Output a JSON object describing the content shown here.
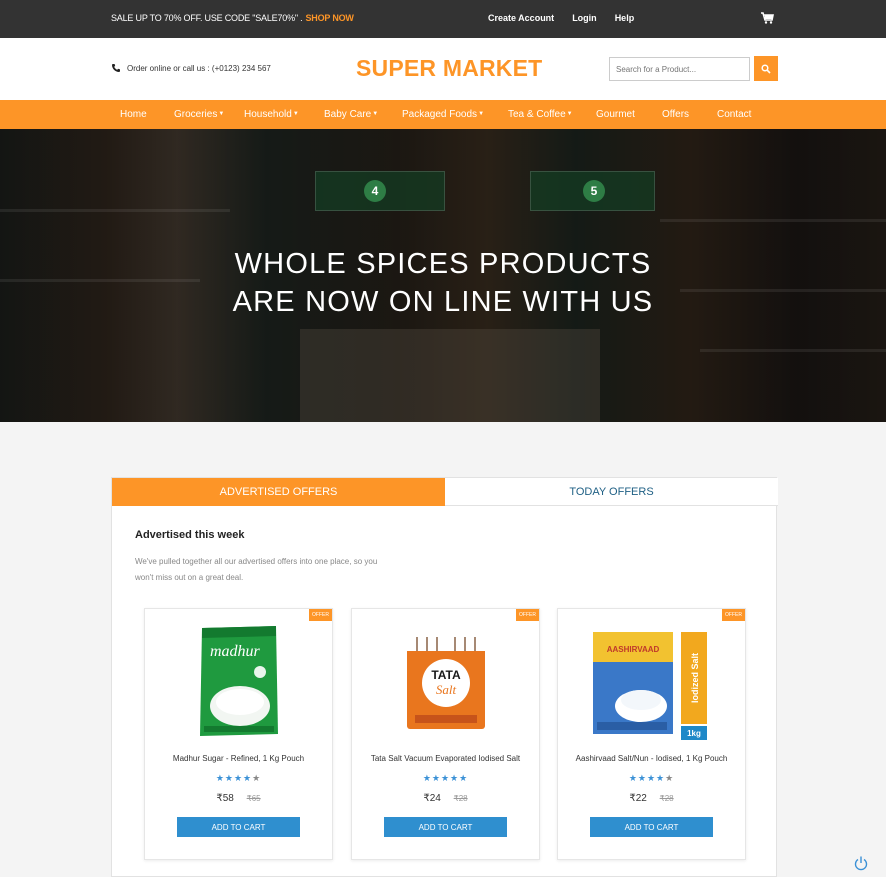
{
  "topbar": {
    "promo_text": "SALE UP TO 70% OFF. USE CODE \"SALE70%\" .",
    "shop_now": "SHOP NOW",
    "links": [
      "Create Account",
      "Login",
      "Help"
    ],
    "cart_icon": "cart-icon"
  },
  "header": {
    "phone_text": "Order online or call us : (+0123) 234 567",
    "logo": "SUPER MARKET",
    "search_placeholder": "Search for a Product...",
    "search_icon": "search-icon"
  },
  "nav": {
    "items": [
      {
        "label": "Home",
        "dropdown": false
      },
      {
        "label": "Groceries",
        "dropdown": true
      },
      {
        "label": "Household",
        "dropdown": true
      },
      {
        "label": "Baby Care",
        "dropdown": true
      },
      {
        "label": "Packaged Foods",
        "dropdown": true
      },
      {
        "label": "Tea & Coffee",
        "dropdown": true
      },
      {
        "label": "Gourmet",
        "dropdown": false
      },
      {
        "label": "Offers",
        "dropdown": false
      },
      {
        "label": "Contact",
        "dropdown": false
      }
    ]
  },
  "hero": {
    "line1": "WHOLE SPICES PRODUCTS",
    "line2": "ARE NOW ON LINE WITH US",
    "aisle_numbers": [
      "4",
      "5"
    ]
  },
  "offers": {
    "tabs": [
      "ADVERTISED OFFERS",
      "TODAY OFFERS"
    ],
    "active_tab": 0,
    "title": "Advertised this week",
    "description": "We've pulled together all our advertised offers into one place, so you won't miss out on a great deal.",
    "products": [
      {
        "badge": "OFFER",
        "name": "Madhur Sugar - Refined, 1 Kg Pouch",
        "rating": 4,
        "price": "₹58",
        "old_price": "₹65",
        "button": "ADD TO CART"
      },
      {
        "badge": "OFFER",
        "name": "Tata Salt Vacuum Evaporated Iodised Salt",
        "rating": 5,
        "price": "₹24",
        "old_price": "₹28",
        "button": "ADD TO CART"
      },
      {
        "badge": "OFFER",
        "name": "Aashirvaad Salt/Nun - Iodised, 1 Kg Pouch",
        "rating": 4,
        "price": "₹22",
        "old_price": "₹28",
        "button": "ADD TO CART"
      }
    ]
  },
  "packaging_text": {
    "madhur": "madhur",
    "tata_1": "TATA",
    "tata_2": "Salt",
    "aashirvaad": "AASHIRVAAD",
    "iodized": "Iodized Salt",
    "weight": "1kg"
  },
  "colors": {
    "accent": "#fd9527",
    "topbar": "#333333",
    "button_blue": "#2f8fcf",
    "star_blue": "#3b91d6",
    "tab_text": "#1e5f84"
  }
}
